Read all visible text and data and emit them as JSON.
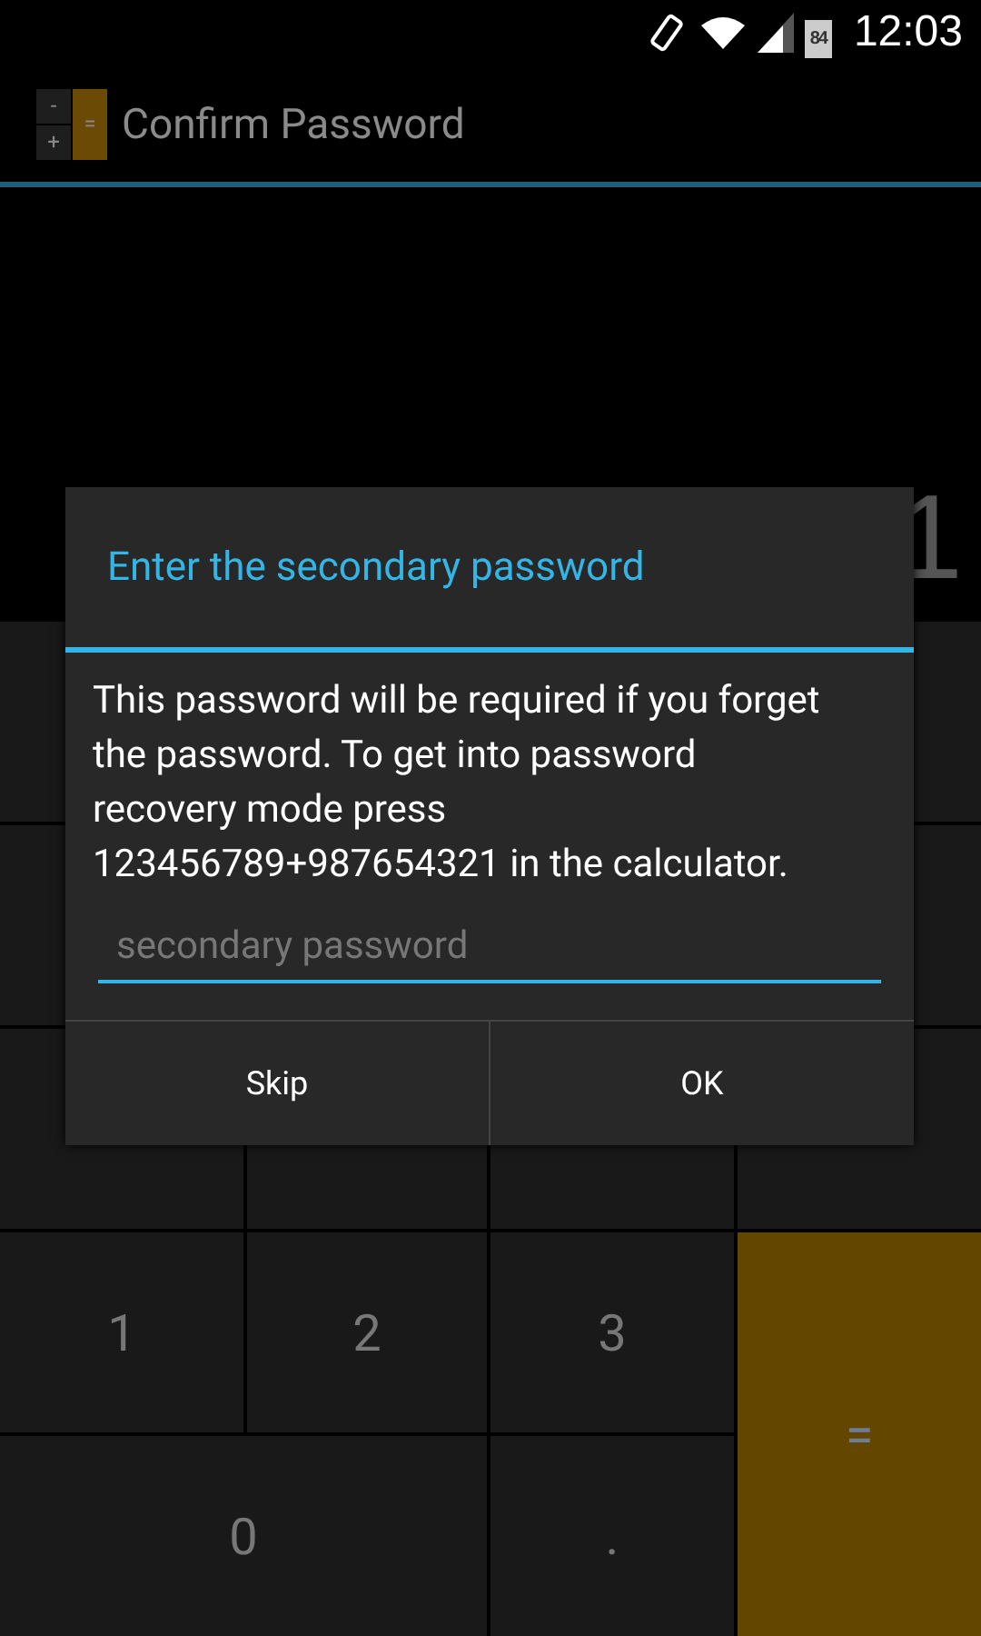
{
  "status_bar": {
    "battery": "84",
    "time": "12:03"
  },
  "action_bar": {
    "icon_keys": [
      "-",
      "+",
      "="
    ],
    "title": "Confirm Password"
  },
  "display": {
    "value": "1"
  },
  "keypad": [
    {
      "label": "1",
      "kind": "digit"
    },
    {
      "label": "2",
      "kind": "digit"
    },
    {
      "label": "3",
      "kind": "digit"
    },
    {
      "label": "=",
      "kind": "equals"
    },
    {
      "label": "0",
      "kind": "wide"
    },
    {
      "label": ".",
      "kind": "digit"
    }
  ],
  "dialog": {
    "title": "Enter the secondary password",
    "message": "This password will be required if you forget the password. To get into password recovery mode press 123456789+987654321 in the calculator.",
    "field": {
      "placeholder": "secondary password"
    },
    "buttons": [
      "Skip",
      "OK"
    ]
  }
}
